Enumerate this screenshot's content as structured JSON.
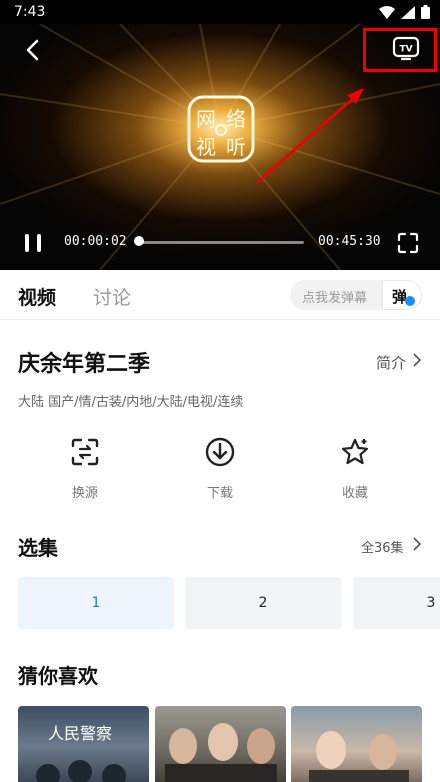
{
  "status": {
    "time": "7:43"
  },
  "player": {
    "current_time": "00:00:02",
    "total_time": "00:45:30",
    "progress": 0.001,
    "logo_chars": [
      "网",
      "络",
      "视",
      "听"
    ]
  },
  "tabs": {
    "video": "视频",
    "discuss": "讨论"
  },
  "danmaku": {
    "placeholder": "点我发弹幕",
    "button": "弹"
  },
  "show": {
    "title": "庆余年第二季",
    "intro_link": "简介",
    "tags": "大陆  国产/情/古装/内地/大陆/电视/连续"
  },
  "actions": [
    {
      "label": "换源",
      "icon": "switch-source-icon"
    },
    {
      "label": "下载",
      "icon": "download-icon"
    },
    {
      "label": "收藏",
      "icon": "star-icon"
    }
  ],
  "episodes": {
    "title": "选集",
    "all_label": "全36集",
    "items": [
      "1",
      "2",
      "3"
    ],
    "active_index": 0
  },
  "recommendations": {
    "title": "猜你喜欢",
    "items": [
      {
        "overlay": "人民警察"
      },
      {
        "overlay": ""
      },
      {
        "overlay": ""
      }
    ]
  },
  "colors": {
    "accent": "#1a7fd6",
    "highlight": "#e00000",
    "player_bg": "#050505"
  }
}
